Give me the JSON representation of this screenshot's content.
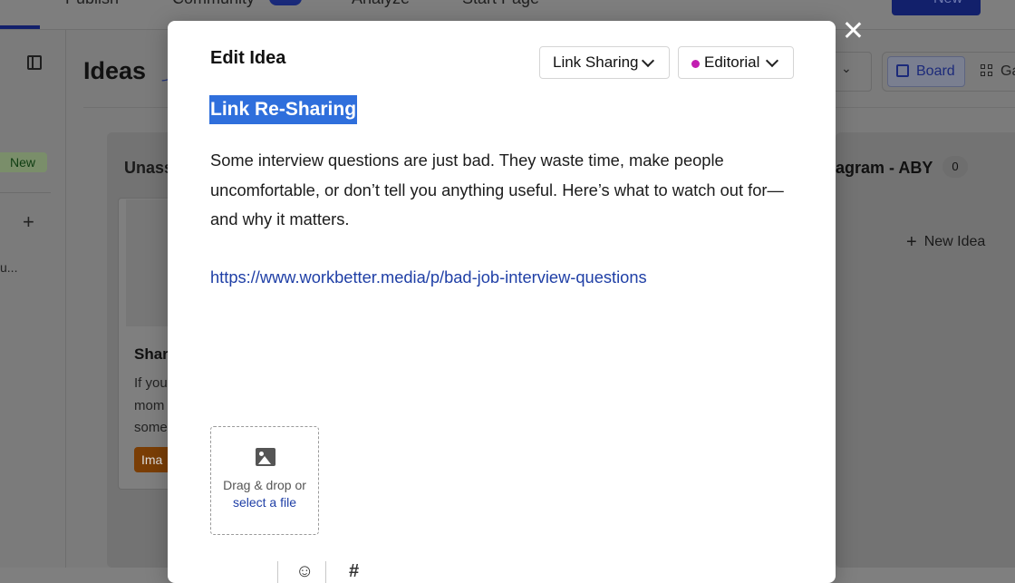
{
  "app": {
    "nav": {
      "item1": "Publish",
      "item2": "Community",
      "item3": "Analyze",
      "item4": "Start Page",
      "primary_button": "New"
    },
    "sidebar": {
      "new_badge": "New",
      "plus": "+",
      "ellipsis": "u..."
    },
    "page_title": "Ideas",
    "views": {
      "board": "Board",
      "gallery": "Ga"
    },
    "left_column": {
      "title": "Unass",
      "card": {
        "title": "Shar",
        "line1": "If you",
        "line2": "mom",
        "line3": "some",
        "tag": "Ima"
      }
    },
    "right_column": {
      "title": "agram - ABY",
      "count": "0",
      "new_idea": "New Idea"
    }
  },
  "modal": {
    "title": "Edit Idea",
    "group_dropdown": "Link Sharing",
    "label_dropdown": "Editorial",
    "label_color": "#c21fb1",
    "idea_title": "Link Re-Sharing",
    "body": "Some interview questions are just bad. They waste time, make people uncomfortable, or don’t tell you anything useful. Here’s what to watch out for—and why it matters.",
    "link": "https://www.workbetter.media/p/bad-job-interview-questions",
    "dropzone": {
      "text": "Drag & drop or",
      "link": "select a file"
    }
  }
}
